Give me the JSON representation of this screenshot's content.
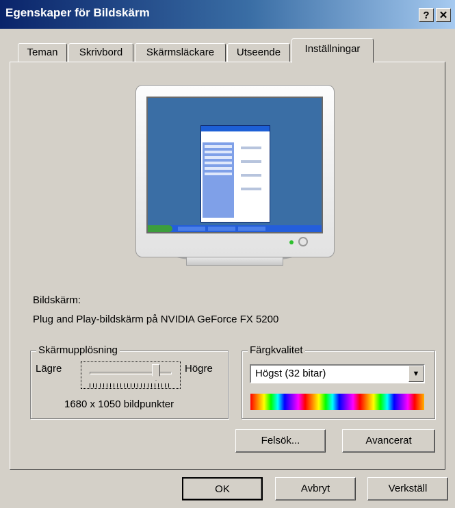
{
  "window": {
    "title": "Egenskaper för Bildskärm",
    "help_label": "?",
    "close_label": "✕"
  },
  "tabs": [
    {
      "label": "Teman"
    },
    {
      "label": "Skrivbord"
    },
    {
      "label": "Skärmsläckare"
    },
    {
      "label": "Utseende"
    },
    {
      "label": "Inställningar",
      "active": true
    }
  ],
  "display": {
    "label": "Bildskärm:",
    "name": "Plug and Play-bildskärm på NVIDIA GeForce FX 5200"
  },
  "resolution": {
    "group_label": "Skärmupplösning",
    "lower_label": "Lägre",
    "higher_label": "Högre",
    "value_text": "1680 x 1050 bildpunkter",
    "slider_position": 0.8
  },
  "color_quality": {
    "group_label": "Färgkvalitet",
    "selected": "Högst (32 bitar)"
  },
  "buttons": {
    "troubleshoot": "Felsök...",
    "advanced": "Avancerat",
    "ok": "OK",
    "cancel": "Avbryt",
    "apply": "Verkställ"
  },
  "colors": {
    "titlebar": "#0a246a",
    "desktop": "#3a6ea5",
    "face": "#d4d0c8"
  }
}
